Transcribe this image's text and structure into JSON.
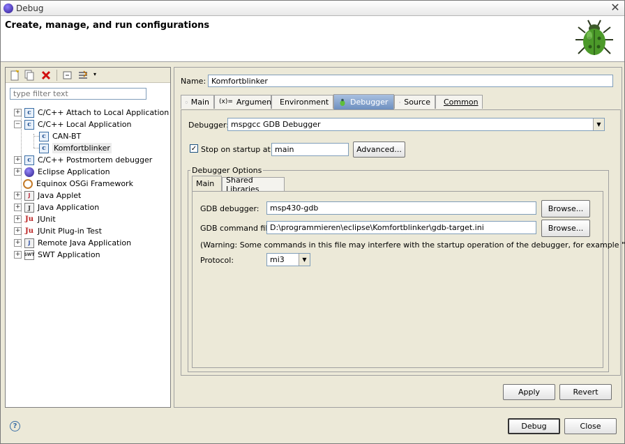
{
  "window": {
    "title": "Debug"
  },
  "banner": {
    "title": "Create, manage, and run configurations"
  },
  "left": {
    "filter_placeholder": "type filter text",
    "tree": [
      {
        "label": "C/C++ Attach to Local Application",
        "icon": "c-config-icon",
        "expander": "+"
      },
      {
        "label": "C/C++ Local Application",
        "icon": "c-config-icon",
        "expander": "-"
      },
      {
        "label": "CAN-BT",
        "icon": "c-config-icon",
        "child": true
      },
      {
        "label": "Komfortblinker",
        "icon": "c-config-icon",
        "child": true,
        "selected": true
      },
      {
        "label": "C/C++ Postmortem debugger",
        "icon": "c-config-icon",
        "expander": "+"
      },
      {
        "label": "Eclipse Application",
        "icon": "eclipse-icon",
        "expander": "+"
      },
      {
        "label": "Equinox OSGi Framework",
        "icon": "osgi-icon"
      },
      {
        "label": "Java Applet",
        "icon": "java-applet-icon",
        "expander": "+"
      },
      {
        "label": "Java Application",
        "icon": "java-app-icon",
        "expander": "+"
      },
      {
        "label": "JUnit",
        "icon": "junit-icon",
        "expander": "+"
      },
      {
        "label": "JUnit Plug-in Test",
        "icon": "junit-plugin-icon",
        "expander": "+"
      },
      {
        "label": "Remote Java Application",
        "icon": "remote-java-icon",
        "expander": "+"
      },
      {
        "label": "SWT Application",
        "icon": "swt-icon",
        "expander": "+"
      }
    ]
  },
  "right": {
    "name_label": "Name:",
    "name_value": "Komfortblinker",
    "tabs": [
      "Main",
      "Arguments",
      "Environment",
      "Debugger",
      "Source",
      "Common"
    ],
    "active_tab": "Debugger",
    "debugger_label": "Debugger:",
    "debugger_value": "mspgcc GDB Debugger",
    "stop_label": "Stop on startup at:",
    "stop_checked": true,
    "stop_value": "main",
    "advanced_label": "Advanced...",
    "options_group": "Debugger Options",
    "inner_tabs": [
      "Main",
      "Shared Libraries"
    ],
    "gdb_debugger_label": "GDB debugger:",
    "gdb_debugger_value": "msp430-gdb",
    "gdb_cmd_label": "GDB command file:",
    "gdb_cmd_value": "D:\\programmieren\\eclipse\\Komfortblinker\\gdb-target.ini",
    "browse_label": "Browse...",
    "warning": "(Warning: Some commands in this file may interfere with the startup operation of the debugger, for example \"run\".)",
    "protocol_label": "Protocol:",
    "protocol_value": "mi3",
    "apply_label": "Apply",
    "revert_label": "Revert"
  },
  "footer": {
    "help_icon": "?",
    "debug_label": "Debug",
    "close_label": "Close"
  }
}
